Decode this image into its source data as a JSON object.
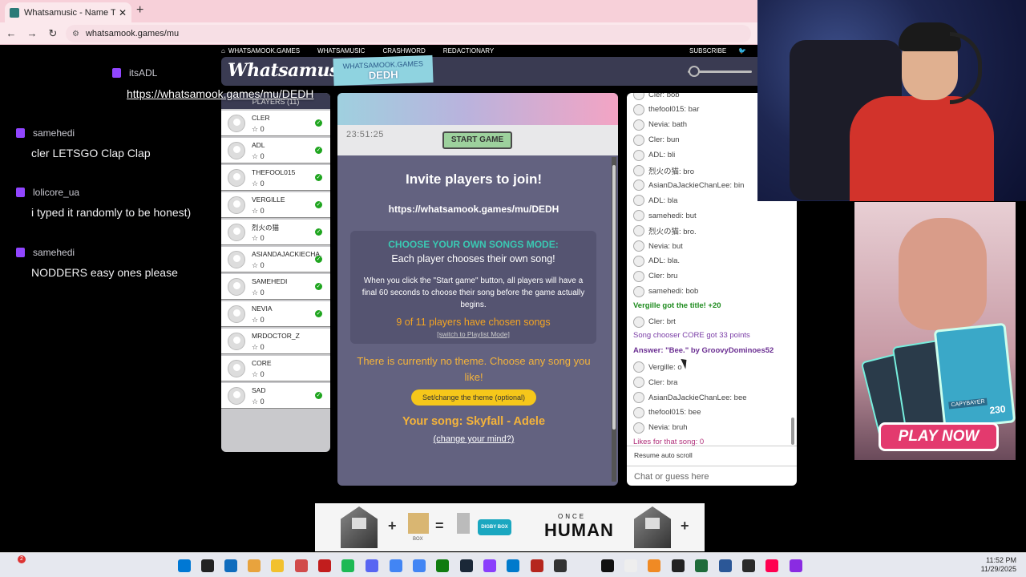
{
  "browser": {
    "tab_title": "Whatsamusic - Name That Tun",
    "url": "whatsamook.games/mu"
  },
  "stream": {
    "streamer_name": "itsADL",
    "room_url": "https://whatsamook.games/mu/DEDH"
  },
  "twitch_chat": [
    {
      "user": "samehedi",
      "text": "cler LETSGO Clap Clap"
    },
    {
      "user": "lolicore_ua",
      "text": "i typed it randomly to be honest)"
    },
    {
      "user": "samehedi",
      "text": "NODDERS easy ones please"
    }
  ],
  "site": {
    "nav": [
      "WHATSAMOOK.GAMES",
      "WHATSAMUSIC",
      "CRASHWORD",
      "REDACTIONARY"
    ],
    "subscribe": "SUBSCRIBE",
    "logo": "Whatsamusic",
    "room_badge_line1": "WHATSAMOOK.GAMES",
    "room_badge_line2": "DEDH"
  },
  "players_panel": {
    "header": "PLAYERS (11)",
    "players": [
      {
        "name": "CLER",
        "score": "0",
        "ready": true
      },
      {
        "name": "ADL",
        "score": "0",
        "ready": true
      },
      {
        "name": "THEFOOL015",
        "score": "0",
        "ready": true
      },
      {
        "name": "VERGILLE",
        "score": "0",
        "ready": true
      },
      {
        "name": "烈火の猫",
        "score": "0",
        "ready": true
      },
      {
        "name": "ASIANDAJACKIECHA...",
        "score": "0",
        "ready": true
      },
      {
        "name": "SAMEHEDI",
        "score": "0",
        "ready": true
      },
      {
        "name": "NEVIA",
        "score": "0",
        "ready": true
      },
      {
        "name": "MRDOCTOR_Z",
        "score": "0",
        "ready": false
      },
      {
        "name": "CORE",
        "score": "0",
        "ready": false
      },
      {
        "name": "SAD",
        "score": "0",
        "ready": true
      }
    ]
  },
  "game": {
    "timer": "23:51:25",
    "start_button": "START GAME",
    "invite_title": "Invite players to join!",
    "invite_url": "https://whatsamook.games/mu/DEDH",
    "mode_title": "CHOOSE YOUR OWN SONGS MODE:",
    "mode_subtitle": "Each player chooses their own song!",
    "mode_desc": "When you click the \"Start game\" button, all players will have a final 60 seconds to choose their song before the game actually begins.",
    "chosen_count": "9 of 11 players have chosen songs",
    "switch_mode": "[switch to Playlist Mode]",
    "theme_text": "There is currently no theme. Choose any song you like!",
    "theme_button": "Set/change the theme (optional)",
    "your_song": "Your song: Skyfall - Adele",
    "change_mind": "(change your mind?)"
  },
  "game_chat": {
    "messages": [
      {
        "text": "Cler: bob",
        "style": "normal"
      },
      {
        "text": "thefool015: bar",
        "style": "normal"
      },
      {
        "text": "Nevia: bath",
        "style": "normal"
      },
      {
        "text": "Cler: bun",
        "style": "normal"
      },
      {
        "text": "ADL: bli",
        "style": "normal"
      },
      {
        "text": "烈火の猫: bro",
        "style": "normal"
      },
      {
        "text": "AsianDaJackieChanLee: bin",
        "style": "normal"
      },
      {
        "text": "ADL: bla",
        "style": "normal"
      },
      {
        "text": "samehedi: but",
        "style": "normal"
      },
      {
        "text": "烈火の猫: bro.",
        "style": "normal"
      },
      {
        "text": "Nevia: but",
        "style": "normal"
      },
      {
        "text": "ADL: bla.",
        "style": "normal"
      },
      {
        "text": "Cler: bru",
        "style": "normal"
      },
      {
        "text": "samehedi: bob",
        "style": "normal"
      },
      {
        "text": "Vergille got the title! +20",
        "style": "green"
      },
      {
        "text": "Cler: brt",
        "style": "normal"
      },
      {
        "text": "Song chooser CORE got 33 points",
        "style": "purple"
      },
      {
        "text": "Answer: \"Bee.\" by GroovyDominoes52",
        "style": "purple-b"
      },
      {
        "text": "Vergille: o",
        "style": "normal"
      },
      {
        "text": "Cler: bra",
        "style": "normal"
      },
      {
        "text": "AsianDaJackieChanLee: bee",
        "style": "normal"
      },
      {
        "text": "thefool015: bee",
        "style": "normal"
      },
      {
        "text": "Nevia: bruh",
        "style": "normal"
      },
      {
        "text": "Likes for that song: 0",
        "style": "pink"
      }
    ],
    "resume_label": "Resume auto scroll",
    "input_placeholder": "Chat or guess here"
  },
  "ad_right": {
    "card_label": "CAPYBAYER",
    "card_number": "230",
    "cta": "PLAY NOW"
  },
  "ad_bottom": {
    "box_label": "BOX",
    "digby": "DIGBY BOX",
    "once": "ONCE",
    "human": "HUMAN"
  },
  "taskbar": {
    "time": "11:52 PM",
    "date": "11/29/2025",
    "notif_count": "2",
    "colors": [
      "#0078d4",
      "#222222",
      "#0f6cbd",
      "#e8a33d",
      "#f2c12e",
      "#d14b4b",
      "#c21d1d",
      "#1db954",
      "#5865f2",
      "#4285f4",
      "#4285f4",
      "#107c10",
      "#1b2838",
      "#8a3ffc",
      "#007acc",
      "#b5261e",
      "#333333",
      "#111111",
      "#eeeeee",
      "#f08a24",
      "#222222",
      "#1e6b3a",
      "#2b5797",
      "#2a2a2a",
      "#ff0050",
      "#8a2be2"
    ]
  }
}
